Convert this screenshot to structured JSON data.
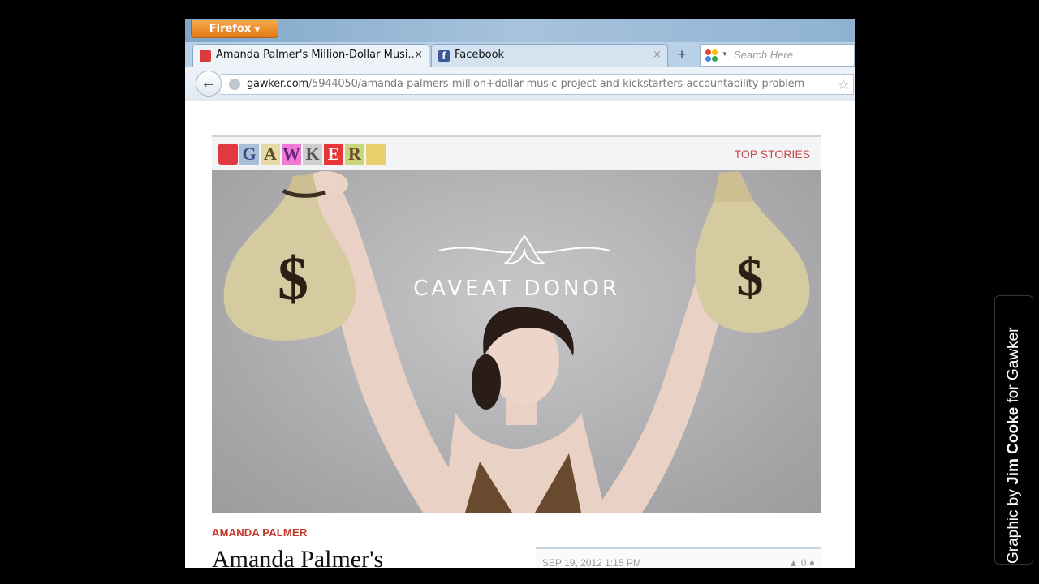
{
  "browser": {
    "menu_button": "Firefox",
    "tabs": [
      {
        "title": "Amanda Palmer's Million-Dollar Musi...",
        "close": "×"
      },
      {
        "title": "Facebook",
        "close": "×"
      }
    ],
    "new_tab": "+",
    "search_placeholder": "Search Here",
    "address": {
      "domain": "gawker.com",
      "path": "/5944050/amanda-palmers-million+dollar-music-project-and-kickstarters-accountability-problem"
    }
  },
  "page": {
    "logo_letters": [
      "",
      "G",
      "A",
      "W",
      "K",
      "E",
      "R",
      ""
    ],
    "top_stories": "TOP STORIES",
    "hero_text": "CAVEAT DONOR",
    "section": "AMANDA PALMER",
    "headline": "Amanda Palmer's",
    "date": "SEP 19, 2012 1:15 PM",
    "counts": "0"
  },
  "caption": {
    "prefix": "Graphic by ",
    "author": "Jim Cooke",
    "suffix": " for Gawker"
  }
}
